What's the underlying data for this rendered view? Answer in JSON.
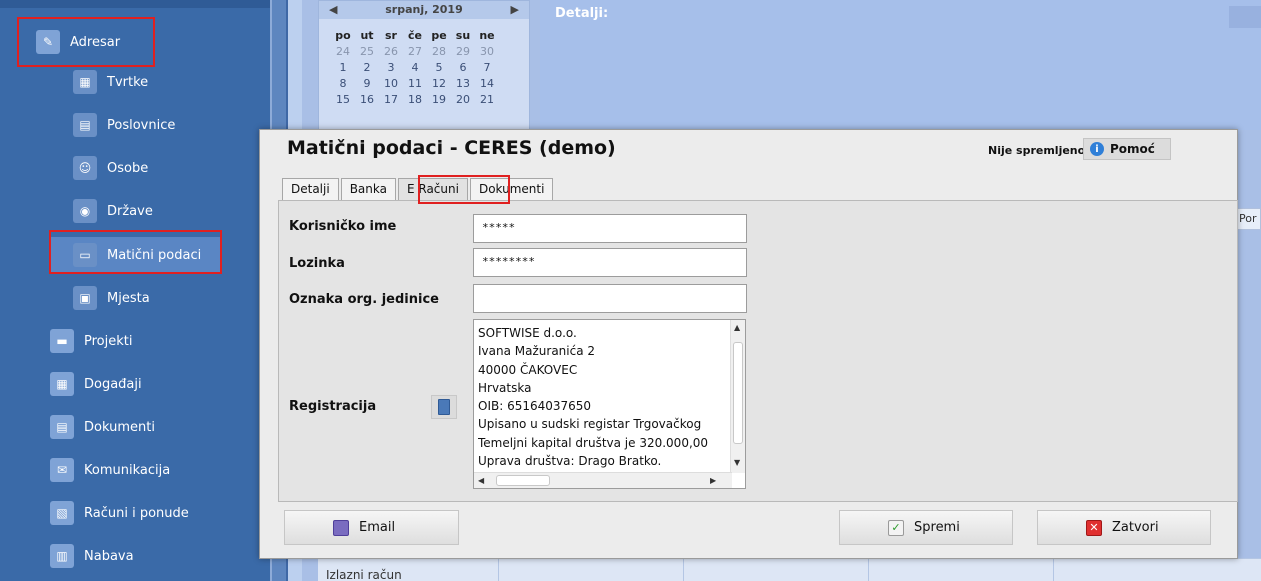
{
  "sidebar": {
    "items": [
      {
        "label": "Adresar",
        "icon": "address-book-icon"
      },
      {
        "label": "Tvrtke",
        "icon": "company-icon"
      },
      {
        "label": "Poslovnice",
        "icon": "branch-icon"
      },
      {
        "label": "Osobe",
        "icon": "people-icon"
      },
      {
        "label": "Države",
        "icon": "globe-icon"
      },
      {
        "label": "Matični podaci",
        "icon": "master-data-icon"
      },
      {
        "label": "Mjesta",
        "icon": "places-icon"
      },
      {
        "label": "Projekti",
        "icon": "projects-icon"
      },
      {
        "label": "Događaji",
        "icon": "calendar-icon"
      },
      {
        "label": "Dokumenti",
        "icon": "documents-icon"
      },
      {
        "label": "Komunikacija",
        "icon": "communication-icon"
      },
      {
        "label": "Računi i ponude",
        "icon": "invoice-icon"
      },
      {
        "label": "Nabava",
        "icon": "purchase-icon"
      }
    ]
  },
  "calendar": {
    "month": "srpanj, 2019",
    "prev": "◀",
    "next": "▶",
    "day_names": [
      "po",
      "ut",
      "sr",
      "če",
      "pe",
      "su",
      "ne"
    ],
    "weeks": [
      [
        "24",
        "25",
        "26",
        "27",
        "28",
        "29",
        "30"
      ],
      [
        "1",
        "2",
        "3",
        "4",
        "5",
        "6",
        "7"
      ],
      [
        "8",
        "9",
        "10",
        "11",
        "12",
        "13",
        "14"
      ],
      [
        "15",
        "16",
        "17",
        "18",
        "19",
        "20",
        "21"
      ]
    ]
  },
  "background": {
    "details_label": "Detalji:",
    "right_tab": "Por",
    "bottom_row_text": "Izlazni račun"
  },
  "modal": {
    "title": "Matični podaci - CERES (demo)",
    "status": "Nije spremljeno",
    "help_label": "Pomoć",
    "tabs": [
      "Detalji",
      "Banka",
      "E Računi",
      "Dokumenti"
    ],
    "active_tab": "E Računi",
    "fields": {
      "username_label": "Korisničko ime",
      "username_value": "*****",
      "password_label": "Lozinka",
      "password_value": "********",
      "org_unit_label": "Oznaka org. jedinice",
      "org_unit_value": "",
      "registration_label": "Registracija",
      "registration_text": "SOFTWISE d.o.o.\nIvana Mažuranića 2\n40000 ČAKOVEC\nHrvatska\nOIB: 65164037650\nUpisano u sudski registar Trgovačkog\nTemeljni kapital društva je 320.000,00\nUprava društva: Drago Bratko."
    },
    "buttons": {
      "email": "Email",
      "save": "Spremi",
      "close": "Zatvori"
    }
  },
  "colors": {
    "sidebar_bg": "#3a6aa8",
    "highlight": "#e02020",
    "accent": "#2f7fd8"
  }
}
